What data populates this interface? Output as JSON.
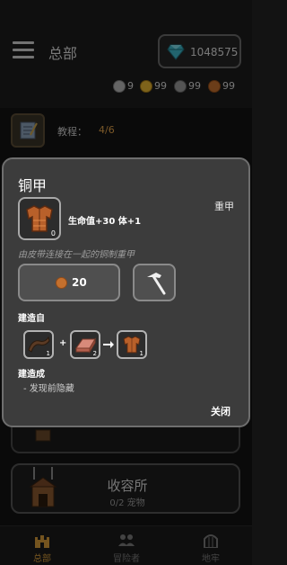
{
  "header": {
    "title": "总部",
    "gems": "1048575",
    "resources": [
      {
        "name": "silver-crown",
        "value": "9",
        "color": "#b8b8b8"
      },
      {
        "name": "gold-crown",
        "value": "99",
        "color": "#e6b432"
      },
      {
        "name": "steel",
        "value": "99",
        "color": "#9a9a9a"
      },
      {
        "name": "copper",
        "value": "99",
        "color": "#c4702e"
      }
    ]
  },
  "tutorial": {
    "label": "教程：",
    "value": "4/6"
  },
  "shelter": {
    "title": "收容所",
    "subtitle": "0/2 宠物"
  },
  "nav": [
    {
      "label": "总部"
    },
    {
      "label": "冒险者"
    },
    {
      "label": "地牢"
    }
  ],
  "popup": {
    "title": "铜甲",
    "item_count": "0",
    "stats": "生命值+30 体+1",
    "category": "重甲",
    "description": "由皮带连接在一起的铜制重甲",
    "cost": "20",
    "crafted_from_label": "建造自",
    "ingredients": [
      {
        "name": "leather-strap",
        "count": "1"
      },
      {
        "name": "copper-bar",
        "count": "2"
      }
    ],
    "plus": "+",
    "result_count": "1",
    "builds_into_label": "建造成",
    "builds_into_item": "- 发现前隐藏",
    "close_label": "关闭"
  },
  "colors": {
    "accent": "#d39a3a",
    "copper": "#c4702e",
    "popup_bg": "#3c3c3c"
  }
}
